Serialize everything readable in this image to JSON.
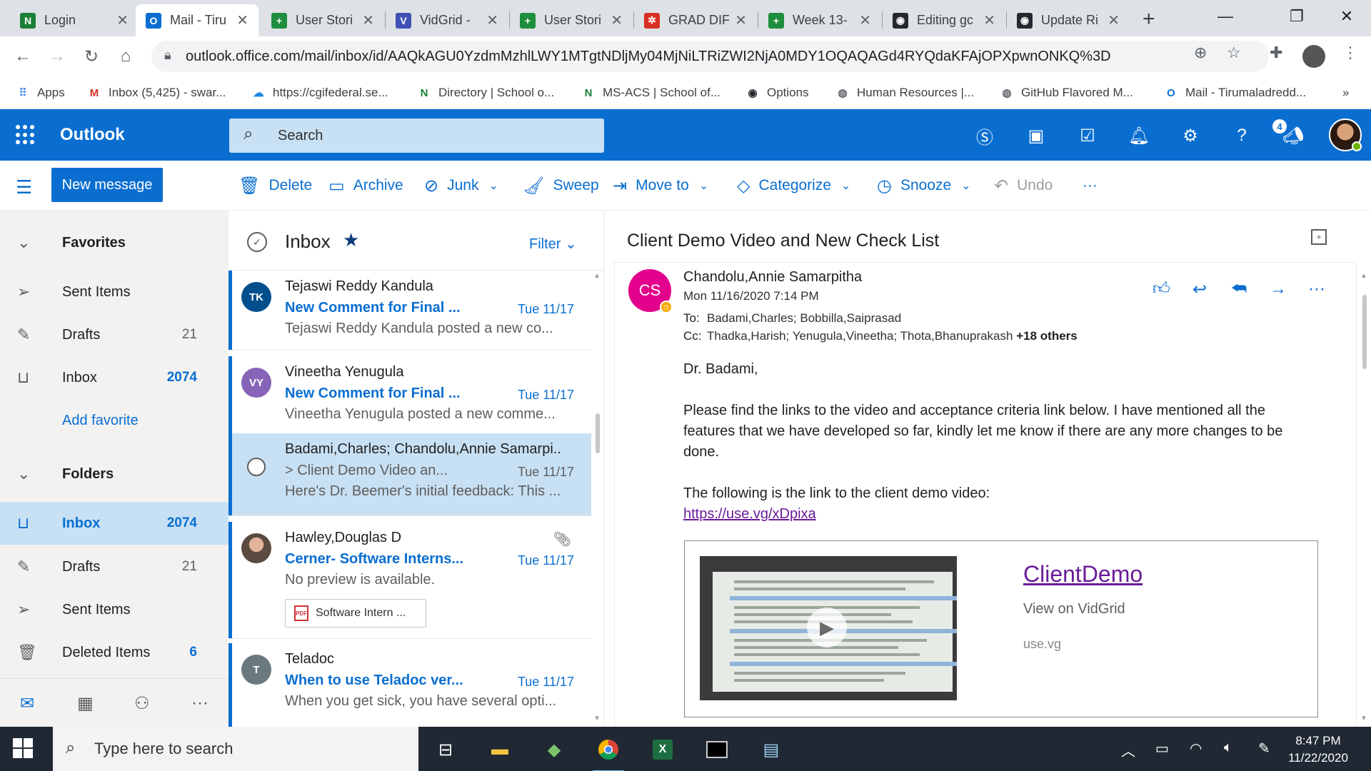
{
  "browser": {
    "tabs": [
      {
        "title": "Login",
        "icon_text": "N",
        "icon_color": "#1a7f37",
        "icon": "notion-n-icon"
      },
      {
        "title": "Mail - Tiru",
        "icon_text": "O",
        "icon_color": "#0a6ed1",
        "icon": "outlook-icon",
        "active": true
      },
      {
        "title": "User Stori",
        "icon_text": "+",
        "icon_color": "#1e8e3e",
        "icon": "sheets-icon"
      },
      {
        "title": "VidGrid - ",
        "icon_text": "V",
        "icon_color": "#3f51b5",
        "icon": "vidgrid-icon"
      },
      {
        "title": "User Stori",
        "icon_text": "+",
        "icon_color": "#1e8e3e",
        "icon": "sheets-icon"
      },
      {
        "title": "GRAD DIF",
        "icon_text": "✲",
        "icon_color": "#d93025",
        "icon": "asana-icon"
      },
      {
        "title": "Week 13-",
        "icon_text": "+",
        "icon_color": "#1e8e3e",
        "icon": "sheets-icon"
      },
      {
        "title": "Editing gc",
        "icon_text": "◉",
        "icon_color": "#24292f",
        "icon": "github-icon"
      },
      {
        "title": "Update Ri",
        "icon_text": "◉",
        "icon_color": "#24292f",
        "icon": "github-icon"
      }
    ],
    "new_tab": "+",
    "url": "outlook.office.com/mail/inbox/id/AAQkAGU0YzdmMzhlLWY1MTgtNDljMy04MjNiLTRiZWI2NjA0MDY1OQAQAGd4RYQdaKFAjOPXpwnONKQ%3D",
    "bookmarks": [
      {
        "label": "Apps",
        "icon": "apps-grid-icon",
        "icon_text": "⠿",
        "icon_color": "#4285f4"
      },
      {
        "label": "Inbox (5,425) - swar...",
        "icon": "gmail-icon",
        "icon_text": "M",
        "icon_color": "#d93025"
      },
      {
        "label": "https://cgifederal.se...",
        "icon": "cloud-icon",
        "icon_text": "☁",
        "icon_color": "#1e88e5"
      },
      {
        "label": "Directory | School o...",
        "icon": "notion-n-icon",
        "icon_text": "N",
        "icon_color": "#1a7f37"
      },
      {
        "label": "MS-ACS | School of...",
        "icon": "notion-n-icon",
        "icon_text": "N",
        "icon_color": "#1a7f37"
      },
      {
        "label": "Options",
        "icon": "github-icon",
        "icon_text": "◉",
        "icon_color": "#24292f"
      },
      {
        "label": "Human Resources |...",
        "icon": "globe-icon",
        "icon_text": "◍",
        "icon_color": "#5f6368"
      },
      {
        "label": "GitHub Flavored M...",
        "icon": "globe-icon",
        "icon_text": "◍",
        "icon_color": "#5f6368"
      },
      {
        "label": "Mail - Tirumaladredd...",
        "icon": "outlook-icon",
        "icon_text": "O",
        "icon_color": "#0a6ed1"
      }
    ],
    "more_bookmarks": "»"
  },
  "outlook": {
    "brand": "Outlook",
    "search_placeholder": "Search",
    "header_badge": "4",
    "accent": "#0a6ed1",
    "commands": {
      "new_message": "New message",
      "delete": "Delete",
      "archive": "Archive",
      "junk": "Junk",
      "sweep": "Sweep",
      "move_to": "Move to",
      "categorize": "Categorize",
      "snooze": "Snooze",
      "undo": "Undo",
      "more": "···"
    },
    "nav": {
      "favorites": "Favorites",
      "fav_items": [
        {
          "label": "Sent Items",
          "count": ""
        },
        {
          "label": "Drafts",
          "count": "21"
        },
        {
          "label": "Inbox",
          "count": "2074"
        }
      ],
      "add_favorite": "Add favorite",
      "folders": "Folders",
      "folder_items": [
        {
          "label": "Inbox",
          "count": "2074"
        },
        {
          "label": "Drafts",
          "count": "21"
        },
        {
          "label": "Sent Items",
          "count": ""
        },
        {
          "label": "Deleted Items",
          "count": "6"
        }
      ]
    },
    "list": {
      "title": "Inbox",
      "filter": "Filter",
      "messages": [
        {
          "initials": "TK",
          "avatar_color": "#004e8c",
          "from": "Tejaswi Reddy Kandula",
          "subject": "New Comment for Final ...",
          "date": "Tue 11/17",
          "preview": "Tejaswi Reddy Kandula posted a new co..."
        },
        {
          "initials": "VY",
          "avatar_color": "#8764b8",
          "from": "Vineetha Yenugula",
          "subject": "New Comment for Final ...",
          "date": "Tue 11/17",
          "preview": "Vineetha Yenugula posted a new comme..."
        },
        {
          "initials": "",
          "avatar_color": "#ffffff",
          "from": "Badami,Charles; Chandolu,Annie Samarpi..",
          "subject": "> Client Demo Video an...",
          "date": "Tue 11/17",
          "preview": "Here's Dr. Beemer's initial feedback: This ..."
        },
        {
          "initials": "",
          "avatar_color": "#8a6b5a",
          "from": "Hawley,Douglas D",
          "subject": "Cerner- Software Interns...",
          "date": "Tue 11/17",
          "preview": "No preview is available.",
          "attachment": "Software Intern ..."
        },
        {
          "initials": "T",
          "avatar_color": "#69797e",
          "from": "Teladoc",
          "subject": "When to use Teladoc ver...",
          "date": "Tue 11/17",
          "preview": "When you get sick, you have several opti..."
        }
      ]
    },
    "reading": {
      "subject": "Client Demo Video and New Check List",
      "sender_initials": "CS",
      "sender": "Chandolu,Annie Samarpitha",
      "sent": "Mon 11/16/2020 7:14 PM",
      "to_label": "To:",
      "to": "Badami,Charles; Bobbilla,Saiprasad",
      "cc_label": "Cc:",
      "cc": "Thadka,Harish; Yenugula,Vineetha; Thota,Bhanuprakash",
      "cc_more": "+18 others",
      "greeting": "Dr. Badami,",
      "para1": "Please find the links to the video and acceptance criteria link below. I have mentioned all the features that we have developed so far, kindly let me know if there are any more changes to be done.",
      "para2": "The following is the link to the client demo video:",
      "link": "https://use.vg/xDpixa",
      "preview_title": "ClientDemo",
      "preview_sub": "View on VidGrid",
      "preview_domain": "use.vg"
    }
  },
  "taskbar": {
    "search_placeholder": "Type here to search",
    "time": "8:47 PM",
    "date": "11/22/2020"
  }
}
